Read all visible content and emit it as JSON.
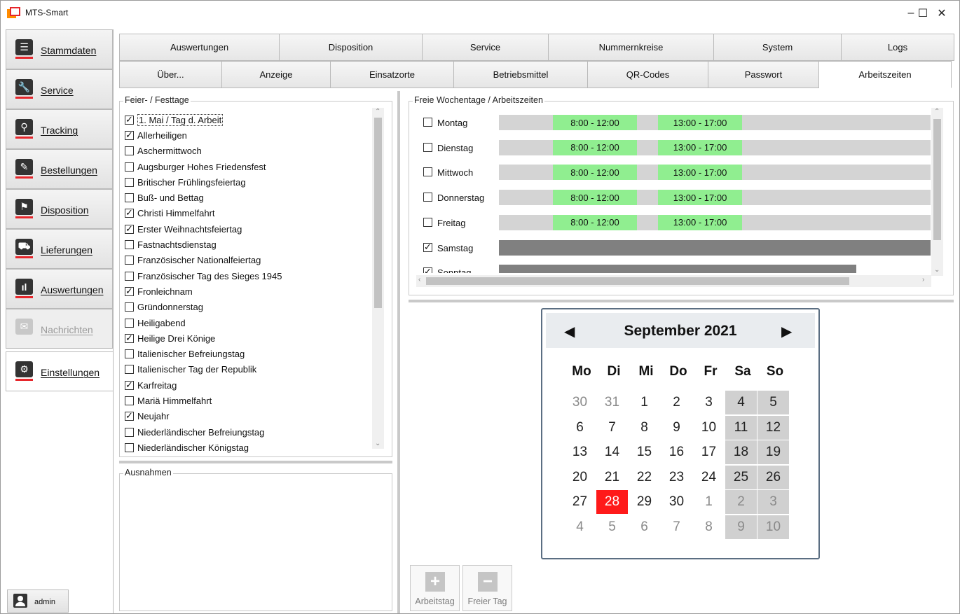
{
  "app": {
    "title": "MTS-Smart"
  },
  "window_controls": {
    "minimize": "–",
    "maximize": "☐",
    "close": "✕"
  },
  "nav": {
    "items": [
      {
        "label": "Stammdaten",
        "icon": "list-icon",
        "glyph": "☰"
      },
      {
        "label": "Service",
        "icon": "wrench-icon",
        "glyph": "🔧"
      },
      {
        "label": "Tracking",
        "icon": "tracking-icon",
        "glyph": "⚲"
      },
      {
        "label": "Bestellungen",
        "icon": "order-icon",
        "glyph": "✎"
      },
      {
        "label": "Disposition",
        "icon": "disposition-icon",
        "glyph": "⚑"
      },
      {
        "label": "Lieferungen",
        "icon": "truck-icon",
        "glyph": "⛟"
      },
      {
        "label": "Auswertungen",
        "icon": "chart-icon",
        "glyph": "ıl"
      },
      {
        "label": "Nachrichten",
        "icon": "mail-icon",
        "glyph": "✉"
      },
      {
        "label": "Einstellungen",
        "icon": "gear-icon",
        "glyph": "⚙"
      }
    ],
    "user": "admin"
  },
  "tabs": {
    "row1": [
      "Auswertungen",
      "Disposition",
      "Service",
      "Nummernkreise",
      "System",
      "Logs"
    ],
    "row2": [
      "Über...",
      "Anzeige",
      "Einsatzorte",
      "Betriebsmittel",
      "QR-Codes",
      "Passwort",
      "Arbeitszeiten"
    ]
  },
  "holidays": {
    "title": "Feier- / Festtage",
    "items": [
      {
        "label": "1. Mai / Tag d. Arbeit",
        "checked": true
      },
      {
        "label": "Allerheiligen",
        "checked": true
      },
      {
        "label": "Aschermittwoch",
        "checked": false
      },
      {
        "label": "Augsburger Hohes Friedensfest",
        "checked": false
      },
      {
        "label": "Britischer Frühlingsfeiertag",
        "checked": false
      },
      {
        "label": "Buß- und Bettag",
        "checked": false
      },
      {
        "label": "Christi Himmelfahrt",
        "checked": true
      },
      {
        "label": "Erster Weihnachtsfeiertag",
        "checked": true
      },
      {
        "label": "Fastnachtsdienstag",
        "checked": false
      },
      {
        "label": "Französischer Nationalfeiertag",
        "checked": false
      },
      {
        "label": "Französischer Tag des Sieges 1945",
        "checked": false
      },
      {
        "label": "Fronleichnam",
        "checked": true
      },
      {
        "label": "Gründonnerstag",
        "checked": false
      },
      {
        "label": "Heiligabend",
        "checked": false
      },
      {
        "label": "Heilige Drei Könige",
        "checked": true
      },
      {
        "label": "Italienischer Befreiungstag",
        "checked": false
      },
      {
        "label": "Italienischer Tag der Republik",
        "checked": false
      },
      {
        "label": "Karfreitag",
        "checked": true
      },
      {
        "label": "Mariä Himmelfahrt",
        "checked": false
      },
      {
        "label": "Neujahr",
        "checked": true
      },
      {
        "label": "Niederländischer Befreiungstag",
        "checked": false
      },
      {
        "label": "Niederländischer Königstag",
        "checked": false
      }
    ]
  },
  "exceptions": {
    "title": "Ausnahmen"
  },
  "weekdays": {
    "title": "Freie Wochentage / Arbeitszeiten",
    "items": [
      {
        "label": "Montag",
        "checked": false,
        "slots": [
          "8:00 - 12:00",
          "13:00 - 17:00"
        ]
      },
      {
        "label": "Dienstag",
        "checked": false,
        "slots": [
          "8:00 - 12:00",
          "13:00 - 17:00"
        ]
      },
      {
        "label": "Mittwoch",
        "checked": false,
        "slots": [
          "8:00 - 12:00",
          "13:00 - 17:00"
        ]
      },
      {
        "label": "Donnerstag",
        "checked": false,
        "slots": [
          "8:00 - 12:00",
          "13:00 - 17:00"
        ]
      },
      {
        "label": "Freitag",
        "checked": false,
        "slots": [
          "8:00 - 12:00",
          "13:00 - 17:00"
        ]
      },
      {
        "label": "Samstag",
        "checked": true,
        "slots": []
      },
      {
        "label": "Sonntag",
        "checked": true,
        "slots": []
      }
    ]
  },
  "calendar": {
    "month": "September 2021",
    "prev": "◀",
    "next": "▶",
    "weekdays": [
      "Mo",
      "Di",
      "Mi",
      "Do",
      "Fr",
      "Sa",
      "So"
    ],
    "weeks": [
      [
        "30",
        "31",
        "1",
        "2",
        "3",
        "4",
        "5"
      ],
      [
        "6",
        "7",
        "8",
        "9",
        "10",
        "11",
        "12"
      ],
      [
        "13",
        "14",
        "15",
        "16",
        "17",
        "18",
        "19"
      ],
      [
        "20",
        "21",
        "22",
        "23",
        "24",
        "25",
        "26"
      ],
      [
        "27",
        "28",
        "29",
        "30",
        "1",
        "2",
        "3"
      ],
      [
        "4",
        "5",
        "6",
        "7",
        "8",
        "9",
        "10"
      ]
    ],
    "today": "28"
  },
  "actions": {
    "add": {
      "label": "Arbeitstag",
      "glyph": "+"
    },
    "remove": {
      "label": "Freier Tag",
      "glyph": "−"
    }
  },
  "colors": {
    "accent_red": "#e6262b",
    "slot_green": "#90ee90",
    "today_red": "#ff1a1a",
    "weekend_gray": "#d0d0d0"
  }
}
